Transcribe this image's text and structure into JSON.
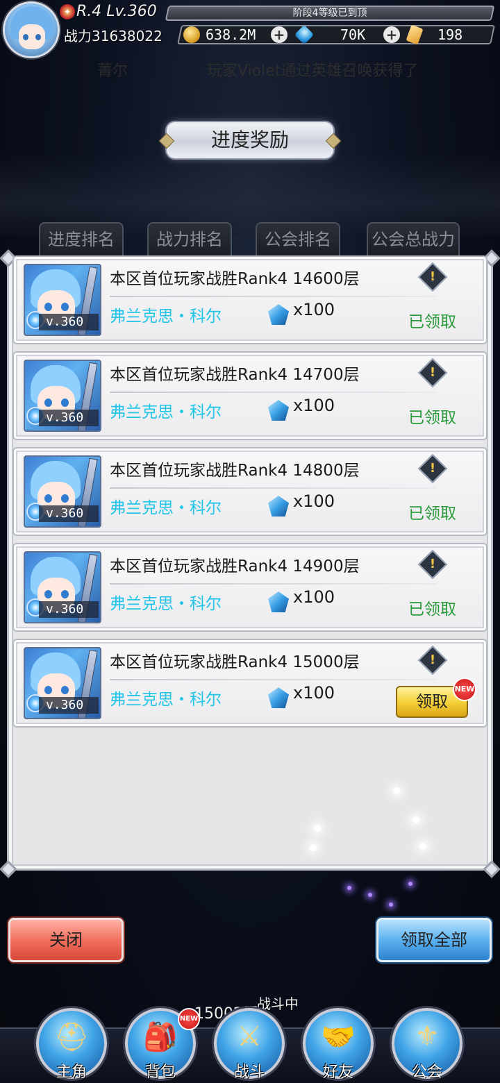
{
  "hud": {
    "rank_level": "R.4 Lv.360",
    "stage_status": "阶段4等级已到顶",
    "power": "战力31638022",
    "gold": "638.2M",
    "diamonds": "70K",
    "tickets": "198"
  },
  "ticker": {
    "prefix": "菁尔",
    "message": "玩家Violet通过英雄召唤获得了"
  },
  "title": "进度奖励",
  "tabs": [
    "进度排名",
    "战力排名",
    "公会排名",
    "公会总战力"
  ],
  "rows": [
    {
      "title": "本区首位玩家战胜Rank4 14600层",
      "hero": "弗兰克思・科尔",
      "level": "v.360",
      "qty": "x100",
      "status": "已领取"
    },
    {
      "title": "本区首位玩家战胜Rank4 14700层",
      "hero": "弗兰克思・科尔",
      "level": "v.360",
      "qty": "x100",
      "status": "已领取"
    },
    {
      "title": "本区首位玩家战胜Rank4 14800层",
      "hero": "弗兰克思・科尔",
      "level": "v.360",
      "qty": "x100",
      "status": "已领取"
    },
    {
      "title": "本区首位玩家战胜Rank4 14900层",
      "hero": "弗兰克思・科尔",
      "level": "v.360",
      "qty": "x100",
      "status": "已领取"
    },
    {
      "title": "本区首位玩家战胜Rank4 15000层",
      "hero": "弗兰克思・科尔",
      "level": "v.360",
      "qty": "x100",
      "button": "领取",
      "badge": "NEW"
    }
  ],
  "buttons": {
    "close": "关闭",
    "claim_all": "领取全部"
  },
  "battle": {
    "floor": "15002层",
    "status": "战斗中"
  },
  "nav": [
    {
      "label": "主角",
      "icon": "helmet-icon"
    },
    {
      "label": "背包",
      "icon": "backpack-icon",
      "badge": "NEW"
    },
    {
      "label": "战斗",
      "icon": "swords-icon"
    },
    {
      "label": "好友",
      "icon": "handshake-icon"
    },
    {
      "label": "公会",
      "icon": "guild-crest-icon"
    }
  ],
  "colors": {
    "hero_name": "#22c4e8",
    "claimed_text": "#2a9a3a",
    "claim_button": "#f5d13c",
    "close_button": "#f0705e",
    "claim_all_button": "#5bb1ee"
  }
}
